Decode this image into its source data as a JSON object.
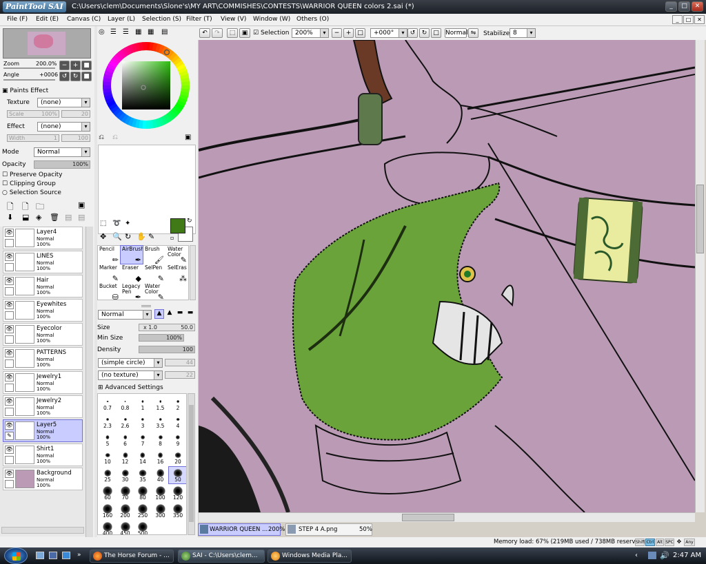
{
  "window": {
    "app_logo": "PaintTool SAI",
    "title": "C:\\Users\\clem\\Documents\\Slone's\\MY ART\\COMMISHES\\CONTESTS\\WARRIOR QUEEN colors 2.sai (*)"
  },
  "menu": [
    "File (F)",
    "Edit (E)",
    "Canvas (C)",
    "Layer (L)",
    "Selection (S)",
    "Filter (T)",
    "View (V)",
    "Window (W)",
    "Others (O)"
  ],
  "navigator": {
    "zoom_label": "Zoom",
    "zoom_value": "200.0%",
    "angle_label": "Angle",
    "angle_value": "+0006"
  },
  "paints_effect": {
    "header": "Paints Effect",
    "texture_label": "Texture",
    "texture_value": "(none)",
    "scale_label": "Scale",
    "scale_value": "100%",
    "scale_num": "20",
    "effect_label": "Effect",
    "effect_value": "(none)",
    "width_label": "Width",
    "width_value": "1",
    "width_num": "100"
  },
  "layer_props": {
    "mode_label": "Mode",
    "mode_value": "Normal",
    "opacity_label": "Opacity",
    "opacity_value": "100%",
    "opacity_level": 1.0,
    "preserve_opacity": "Preserve Opacity",
    "clipping_group": "Clipping Group",
    "selection_source": "Selection Source"
  },
  "layers": [
    {
      "name": "Layer4",
      "mode": "Normal",
      "opacity": "100%",
      "selected": false
    },
    {
      "name": "LINES",
      "mode": "Normal",
      "opacity": "100%",
      "selected": false
    },
    {
      "name": "Hair",
      "mode": "Normal",
      "opacity": "100%",
      "selected": false
    },
    {
      "name": "Eyewhites",
      "mode": "Normal",
      "opacity": "100%",
      "selected": false
    },
    {
      "name": "Eyecolor",
      "mode": "Normal",
      "opacity": "100%",
      "selected": false
    },
    {
      "name": "PATTERNS",
      "mode": "Normal",
      "opacity": "100%",
      "selected": false
    },
    {
      "name": "Jewelry1",
      "mode": "Normal",
      "opacity": "100%",
      "selected": false
    },
    {
      "name": "Jewelry2",
      "mode": "Normal",
      "opacity": "100%",
      "selected": false
    },
    {
      "name": "Layer5",
      "mode": "Normal",
      "opacity": "100%",
      "selected": true
    },
    {
      "name": "Shirt1",
      "mode": "Normal",
      "opacity": "100%",
      "selected": false
    },
    {
      "name": "Background",
      "mode": "Normal",
      "opacity": "100%",
      "selected": false
    }
  ],
  "colors": {
    "foreground": "#3f7a16",
    "background": "#ffffff",
    "canvas_bg": "#bb9ab5",
    "shirt": "#6aa33a",
    "bracelet": "#e9eb9e"
  },
  "tools": [
    {
      "name": "Pencil",
      "icon": "pencil-icon"
    },
    {
      "name": "AirBrush",
      "icon": "airbrush-icon",
      "selected": true
    },
    {
      "name": "Brush",
      "icon": "brush-icon"
    },
    {
      "name": "Water Color",
      "icon": "watercolor-icon"
    },
    {
      "name": "Marker",
      "icon": "marker-icon"
    },
    {
      "name": "Eraser",
      "icon": "eraser-icon"
    },
    {
      "name": "SelPen",
      "icon": "selpen-icon"
    },
    {
      "name": "SelEras",
      "icon": "seleras-icon"
    },
    {
      "name": "Bucket",
      "icon": "bucket-icon"
    },
    {
      "name": "Legacy Pen",
      "icon": "legacy-pen-icon"
    },
    {
      "name": "Water Color",
      "icon": "watercolor-icon"
    }
  ],
  "brush": {
    "mode_value": "Normal",
    "size_label": "Size",
    "size_mult": "x 1.0",
    "size_value": "50.0",
    "minsize_label": "Min Size",
    "minsize_value": "100%",
    "density_label": "Density",
    "density_value": "100",
    "shape_value": "(simple circle)",
    "shape_num": "44",
    "texture_value": "(no texture)",
    "texture_num": "22",
    "advanced": "Advanced Settings"
  },
  "brush_sizes": [
    "0.7",
    "0.8",
    "1",
    "1.5",
    "2",
    "2.3",
    "2.6",
    "3",
    "3.5",
    "4",
    "5",
    "6",
    "7",
    "8",
    "9",
    "10",
    "12",
    "14",
    "16",
    "20",
    "25",
    "30",
    "35",
    "40",
    "50",
    "60",
    "70",
    "80",
    "100",
    "120",
    "160",
    "200",
    "250",
    "300",
    "350",
    "400",
    "450",
    "500"
  ],
  "brush_selected": "50",
  "canvas_toolbar": {
    "selection_label": "Selection",
    "zoom": "200%",
    "angle": "+000°",
    "blend": "Normal",
    "stabilizer_label": "Stabilizer",
    "stabilizer_value": "8"
  },
  "doc_tabs": [
    {
      "name": "WARRIOR QUEEN ...",
      "zoom": "200%",
      "active": true
    },
    {
      "name": "STEP 4 A.png",
      "zoom": "50%",
      "active": false
    }
  ],
  "status": {
    "memory": "Memory load: 67% (219MB used / 738MB reserved)",
    "keys": [
      "Shift",
      "Ctrl",
      "Alt",
      "SPC",
      "Any"
    ]
  },
  "taskbar": {
    "tasks": [
      "The Horse Forum - ...",
      "SAI - C:\\Users\\clem...",
      "Windows Media Pla..."
    ],
    "clock": "2:47 AM"
  }
}
